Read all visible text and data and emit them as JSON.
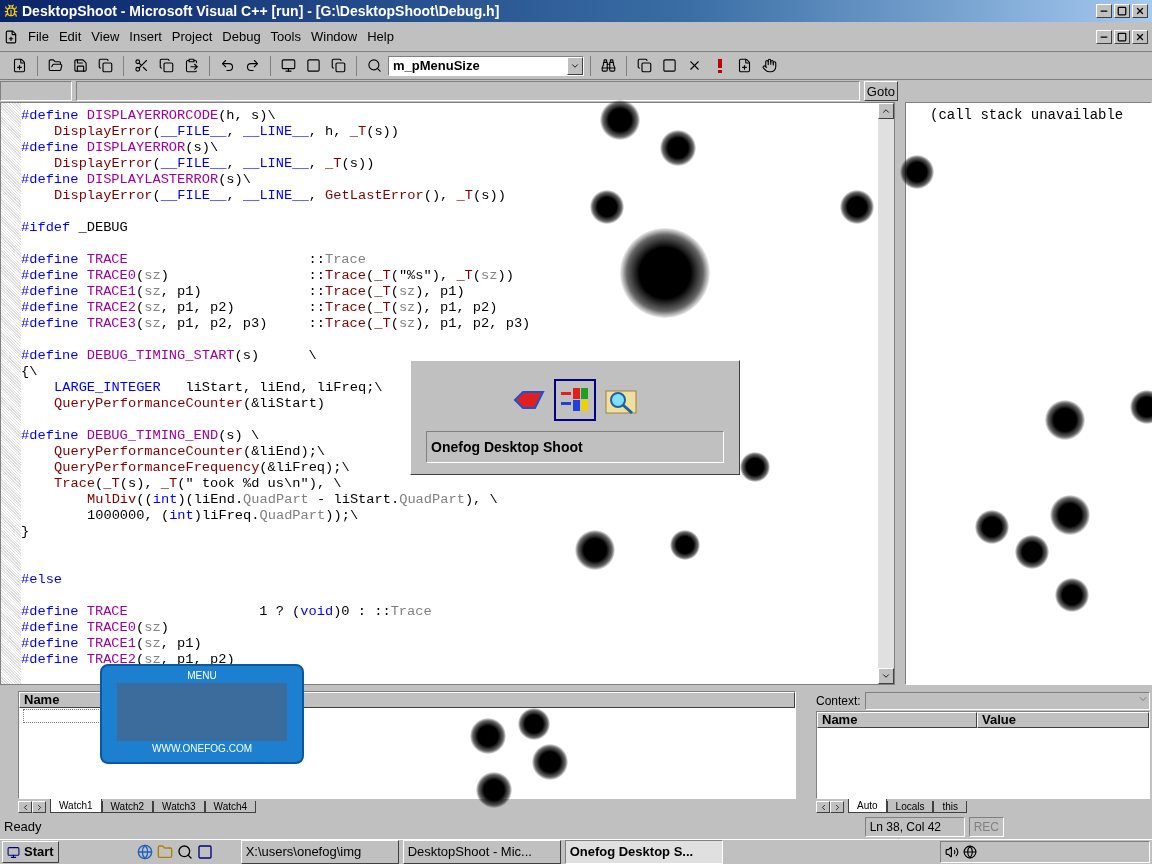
{
  "window": {
    "title": "DesktopShoot - Microsoft Visual C++ [run] - [G:\\DesktopShoot\\Debug.h]"
  },
  "menu": [
    "File",
    "Edit",
    "View",
    "Insert",
    "Project",
    "Debug",
    "Tools",
    "Window",
    "Help"
  ],
  "toolbar": {
    "combo_value": "m_pMenuSize"
  },
  "goto_button": "Goto",
  "code": [
    {
      "kind": "top",
      "tokens": [
        {
          "kind": "pp",
          "text": "#define "
        },
        {
          "kind": "macro",
          "text": "DISPLAYERRORCODE"
        },
        {
          "kind": "plain",
          "text": "(h, s)\\"
        }
      ]
    },
    {
      "kind": "inner",
      "tokens": [
        {
          "kind": "func",
          "text": "DisplayError"
        },
        {
          "kind": "plain",
          "text": "("
        },
        {
          "kind": "pp",
          "text": "__FILE__"
        },
        {
          "kind": "plain",
          "text": ", "
        },
        {
          "kind": "pp",
          "text": "__LINE__"
        },
        {
          "kind": "plain",
          "text": ", h, "
        },
        {
          "kind": "func",
          "text": "_T"
        },
        {
          "kind": "plain",
          "text": "(s))"
        }
      ]
    },
    {
      "kind": "top",
      "tokens": [
        {
          "kind": "pp",
          "text": "#define "
        },
        {
          "kind": "macro",
          "text": "DISPLAYERROR"
        },
        {
          "kind": "plain",
          "text": "(s)\\"
        }
      ]
    },
    {
      "kind": "inner",
      "tokens": [
        {
          "kind": "func",
          "text": "DisplayError"
        },
        {
          "kind": "plain",
          "text": "("
        },
        {
          "kind": "pp",
          "text": "__FILE__"
        },
        {
          "kind": "plain",
          "text": ", "
        },
        {
          "kind": "pp",
          "text": "__LINE__"
        },
        {
          "kind": "plain",
          "text": ", "
        },
        {
          "kind": "func",
          "text": "_T"
        },
        {
          "kind": "plain",
          "text": "(s))"
        }
      ]
    },
    {
      "kind": "top",
      "tokens": [
        {
          "kind": "pp",
          "text": "#define "
        },
        {
          "kind": "macro",
          "text": "DISPLAYLASTERROR"
        },
        {
          "kind": "plain",
          "text": "(s)\\"
        }
      ]
    },
    {
      "kind": "inner",
      "tokens": [
        {
          "kind": "func",
          "text": "DisplayError"
        },
        {
          "kind": "plain",
          "text": "("
        },
        {
          "kind": "pp",
          "text": "__FILE__"
        },
        {
          "kind": "plain",
          "text": ", "
        },
        {
          "kind": "pp",
          "text": "__LINE__"
        },
        {
          "kind": "plain",
          "text": ", "
        },
        {
          "kind": "func",
          "text": "GetLastError"
        },
        {
          "kind": "plain",
          "text": "(), "
        },
        {
          "kind": "func",
          "text": "_T"
        },
        {
          "kind": "plain",
          "text": "(s))"
        }
      ]
    },
    {
      "kind": "blank"
    },
    {
      "kind": "top",
      "tokens": [
        {
          "kind": "pp",
          "text": "#ifdef"
        },
        {
          "kind": "plain",
          "text": " _DEBUG"
        }
      ]
    },
    {
      "kind": "blank"
    },
    {
      "kind": "top",
      "tokens": [
        {
          "kind": "pp",
          "text": "#define "
        },
        {
          "kind": "macro",
          "text": "TRACE"
        },
        {
          "kind": "plain",
          "text": "                      ::"
        },
        {
          "kind": "dim",
          "text": "Trace"
        }
      ]
    },
    {
      "kind": "top",
      "tokens": [
        {
          "kind": "pp",
          "text": "#define "
        },
        {
          "kind": "macro",
          "text": "TRACE0"
        },
        {
          "kind": "plain",
          "text": "("
        },
        {
          "kind": "dim",
          "text": "sz"
        },
        {
          "kind": "plain",
          "text": ")                 ::"
        },
        {
          "kind": "func",
          "text": "Trace"
        },
        {
          "kind": "plain",
          "text": "("
        },
        {
          "kind": "func",
          "text": "_T"
        },
        {
          "kind": "plain",
          "text": "(\"%s\"), "
        },
        {
          "kind": "func",
          "text": "_T"
        },
        {
          "kind": "plain",
          "text": "("
        },
        {
          "kind": "dim",
          "text": "sz"
        },
        {
          "kind": "plain",
          "text": "))"
        }
      ]
    },
    {
      "kind": "top",
      "tokens": [
        {
          "kind": "pp",
          "text": "#define "
        },
        {
          "kind": "macro",
          "text": "TRACE1"
        },
        {
          "kind": "plain",
          "text": "("
        },
        {
          "kind": "dim",
          "text": "sz"
        },
        {
          "kind": "plain",
          "text": ", p1)             ::"
        },
        {
          "kind": "func",
          "text": "Trace"
        },
        {
          "kind": "plain",
          "text": "("
        },
        {
          "kind": "func",
          "text": "_T"
        },
        {
          "kind": "plain",
          "text": "("
        },
        {
          "kind": "dim",
          "text": "sz"
        },
        {
          "kind": "plain",
          "text": "), p1)"
        }
      ]
    },
    {
      "kind": "top",
      "tokens": [
        {
          "kind": "pp",
          "text": "#define "
        },
        {
          "kind": "macro",
          "text": "TRACE2"
        },
        {
          "kind": "plain",
          "text": "("
        },
        {
          "kind": "dim",
          "text": "sz"
        },
        {
          "kind": "plain",
          "text": ", p1, p2)         ::"
        },
        {
          "kind": "func",
          "text": "Trace"
        },
        {
          "kind": "plain",
          "text": "("
        },
        {
          "kind": "func",
          "text": "_T"
        },
        {
          "kind": "plain",
          "text": "("
        },
        {
          "kind": "dim",
          "text": "sz"
        },
        {
          "kind": "plain",
          "text": "), p1, p2)"
        }
      ]
    },
    {
      "kind": "top",
      "tokens": [
        {
          "kind": "pp",
          "text": "#define "
        },
        {
          "kind": "macro",
          "text": "TRACE3"
        },
        {
          "kind": "plain",
          "text": "("
        },
        {
          "kind": "dim",
          "text": "sz"
        },
        {
          "kind": "plain",
          "text": ", p1, p2, p3)     ::"
        },
        {
          "kind": "func",
          "text": "Trace"
        },
        {
          "kind": "plain",
          "text": "("
        },
        {
          "kind": "func",
          "text": "_T"
        },
        {
          "kind": "plain",
          "text": "("
        },
        {
          "kind": "dim",
          "text": "sz"
        },
        {
          "kind": "plain",
          "text": "), p1, p2, p3)"
        }
      ]
    },
    {
      "kind": "blank"
    },
    {
      "kind": "top",
      "tokens": [
        {
          "kind": "pp",
          "text": "#define "
        },
        {
          "kind": "macro",
          "text": "DEBUG_TIMING_START"
        },
        {
          "kind": "plain",
          "text": "(s)      \\"
        }
      ]
    },
    {
      "kind": "top",
      "tokens": [
        {
          "kind": "plain",
          "text": "{\\"
        }
      ]
    },
    {
      "kind": "inner",
      "tokens": [
        {
          "kind": "pp",
          "text": "LARGE_INTEGER"
        },
        {
          "kind": "plain",
          "text": "   liStart, liEnd, liFreq;\\"
        }
      ]
    },
    {
      "kind": "inner",
      "tokens": [
        {
          "kind": "func",
          "text": "QueryPerformanceCounter"
        },
        {
          "kind": "plain",
          "text": "(&liStart)"
        }
      ]
    },
    {
      "kind": "blank"
    },
    {
      "kind": "top",
      "tokens": [
        {
          "kind": "pp",
          "text": "#define "
        },
        {
          "kind": "macro",
          "text": "DEBUG_TIMING_END"
        },
        {
          "kind": "plain",
          "text": "(s) \\"
        }
      ]
    },
    {
      "kind": "inner",
      "tokens": [
        {
          "kind": "func",
          "text": "QueryPerformanceCounter"
        },
        {
          "kind": "plain",
          "text": "(&liEnd);\\"
        }
      ]
    },
    {
      "kind": "inner",
      "tokens": [
        {
          "kind": "func",
          "text": "QueryPerformanceFrequency"
        },
        {
          "kind": "plain",
          "text": "(&liFreq);\\"
        }
      ]
    },
    {
      "kind": "inner",
      "tokens": [
        {
          "kind": "func",
          "text": "Trace"
        },
        {
          "kind": "plain",
          "text": "("
        },
        {
          "kind": "func",
          "text": "_T"
        },
        {
          "kind": "plain",
          "text": "(s), "
        },
        {
          "kind": "func",
          "text": "_T"
        },
        {
          "kind": "plain",
          "text": "(\" took %d us\\n\"), \\"
        }
      ]
    },
    {
      "kind": "deep",
      "tokens": [
        {
          "kind": "func",
          "text": "MulDiv"
        },
        {
          "kind": "plain",
          "text": "(("
        },
        {
          "kind": "pp",
          "text": "int"
        },
        {
          "kind": "plain",
          "text": ")(liEnd."
        },
        {
          "kind": "dim",
          "text": "QuadPart"
        },
        {
          "kind": "plain",
          "text": " - liStart."
        },
        {
          "kind": "dim",
          "text": "QuadPart"
        },
        {
          "kind": "plain",
          "text": "), \\"
        }
      ]
    },
    {
      "kind": "deep",
      "tokens": [
        {
          "kind": "plain",
          "text": "1000000, ("
        },
        {
          "kind": "pp",
          "text": "int"
        },
        {
          "kind": "plain",
          "text": ")liFreq."
        },
        {
          "kind": "dim",
          "text": "QuadPart"
        },
        {
          "kind": "plain",
          "text": "));\\"
        }
      ]
    },
    {
      "kind": "top",
      "tokens": [
        {
          "kind": "plain",
          "text": "}"
        }
      ]
    },
    {
      "kind": "blank"
    },
    {
      "kind": "blank"
    },
    {
      "kind": "top",
      "tokens": [
        {
          "kind": "pp",
          "text": "#else"
        }
      ]
    },
    {
      "kind": "blank"
    },
    {
      "kind": "top",
      "tokens": [
        {
          "kind": "pp",
          "text": "#define "
        },
        {
          "kind": "macro",
          "text": "TRACE"
        },
        {
          "kind": "plain",
          "text": "                1 ? ("
        },
        {
          "kind": "pp",
          "text": "void"
        },
        {
          "kind": "plain",
          "text": ")0 : ::"
        },
        {
          "kind": "dim",
          "text": "Trace"
        }
      ]
    },
    {
      "kind": "top",
      "tokens": [
        {
          "kind": "pp",
          "text": "#define "
        },
        {
          "kind": "macro",
          "text": "TRACE0"
        },
        {
          "kind": "plain",
          "text": "("
        },
        {
          "kind": "dim",
          "text": "sz"
        },
        {
          "kind": "plain",
          "text": ")"
        }
      ]
    },
    {
      "kind": "top",
      "tokens": [
        {
          "kind": "pp",
          "text": "#define "
        },
        {
          "kind": "macro",
          "text": "TRACE1"
        },
        {
          "kind": "plain",
          "text": "("
        },
        {
          "kind": "dim",
          "text": "sz"
        },
        {
          "kind": "plain",
          "text": ", p1)"
        }
      ]
    },
    {
      "kind": "top",
      "tokens": [
        {
          "kind": "pp",
          "text": "#define "
        },
        {
          "kind": "macro",
          "text": "TRACE2"
        },
        {
          "kind": "plain",
          "text": "("
        },
        {
          "kind": "dim",
          "text": "sz"
        },
        {
          "kind": "plain",
          "text": ", p1, p2)"
        }
      ]
    }
  ],
  "call_stack": {
    "text": "(call stack unavailable"
  },
  "popup": {
    "icons": [
      {
        "selected": false
      },
      {
        "selected": true
      },
      {
        "selected": false
      }
    ],
    "label": "Onefog Desktop Shoot"
  },
  "game_menu": {
    "title": "MENU",
    "url": "WWW.ONEFOG.COM"
  },
  "watch": {
    "column": "Name",
    "tabs": [
      {
        "label": "Watch1",
        "selected": true
      },
      {
        "label": "Watch2",
        "selected": false
      },
      {
        "label": "Watch3",
        "selected": false
      },
      {
        "label": "Watch4",
        "selected": false
      }
    ]
  },
  "variables": {
    "context_label": "Context:",
    "columns": [
      "Name",
      "Value"
    ],
    "tabs": [
      {
        "label": "Auto",
        "selected": true
      },
      {
        "label": "Locals",
        "selected": false
      },
      {
        "label": "this",
        "selected": false
      }
    ]
  },
  "status_bar": {
    "text": "Ready",
    "position": "Ln 38, Col 42",
    "rec": "REC"
  },
  "taskbar": {
    "start": "Start",
    "tasks": [
      {
        "label": "X:\\users\\onefog\\img",
        "selected": false
      },
      {
        "label": "DesktopShoot - Mic...",
        "selected": false
      },
      {
        "label": "Onefog Desktop S...",
        "selected": true
      }
    ]
  }
}
